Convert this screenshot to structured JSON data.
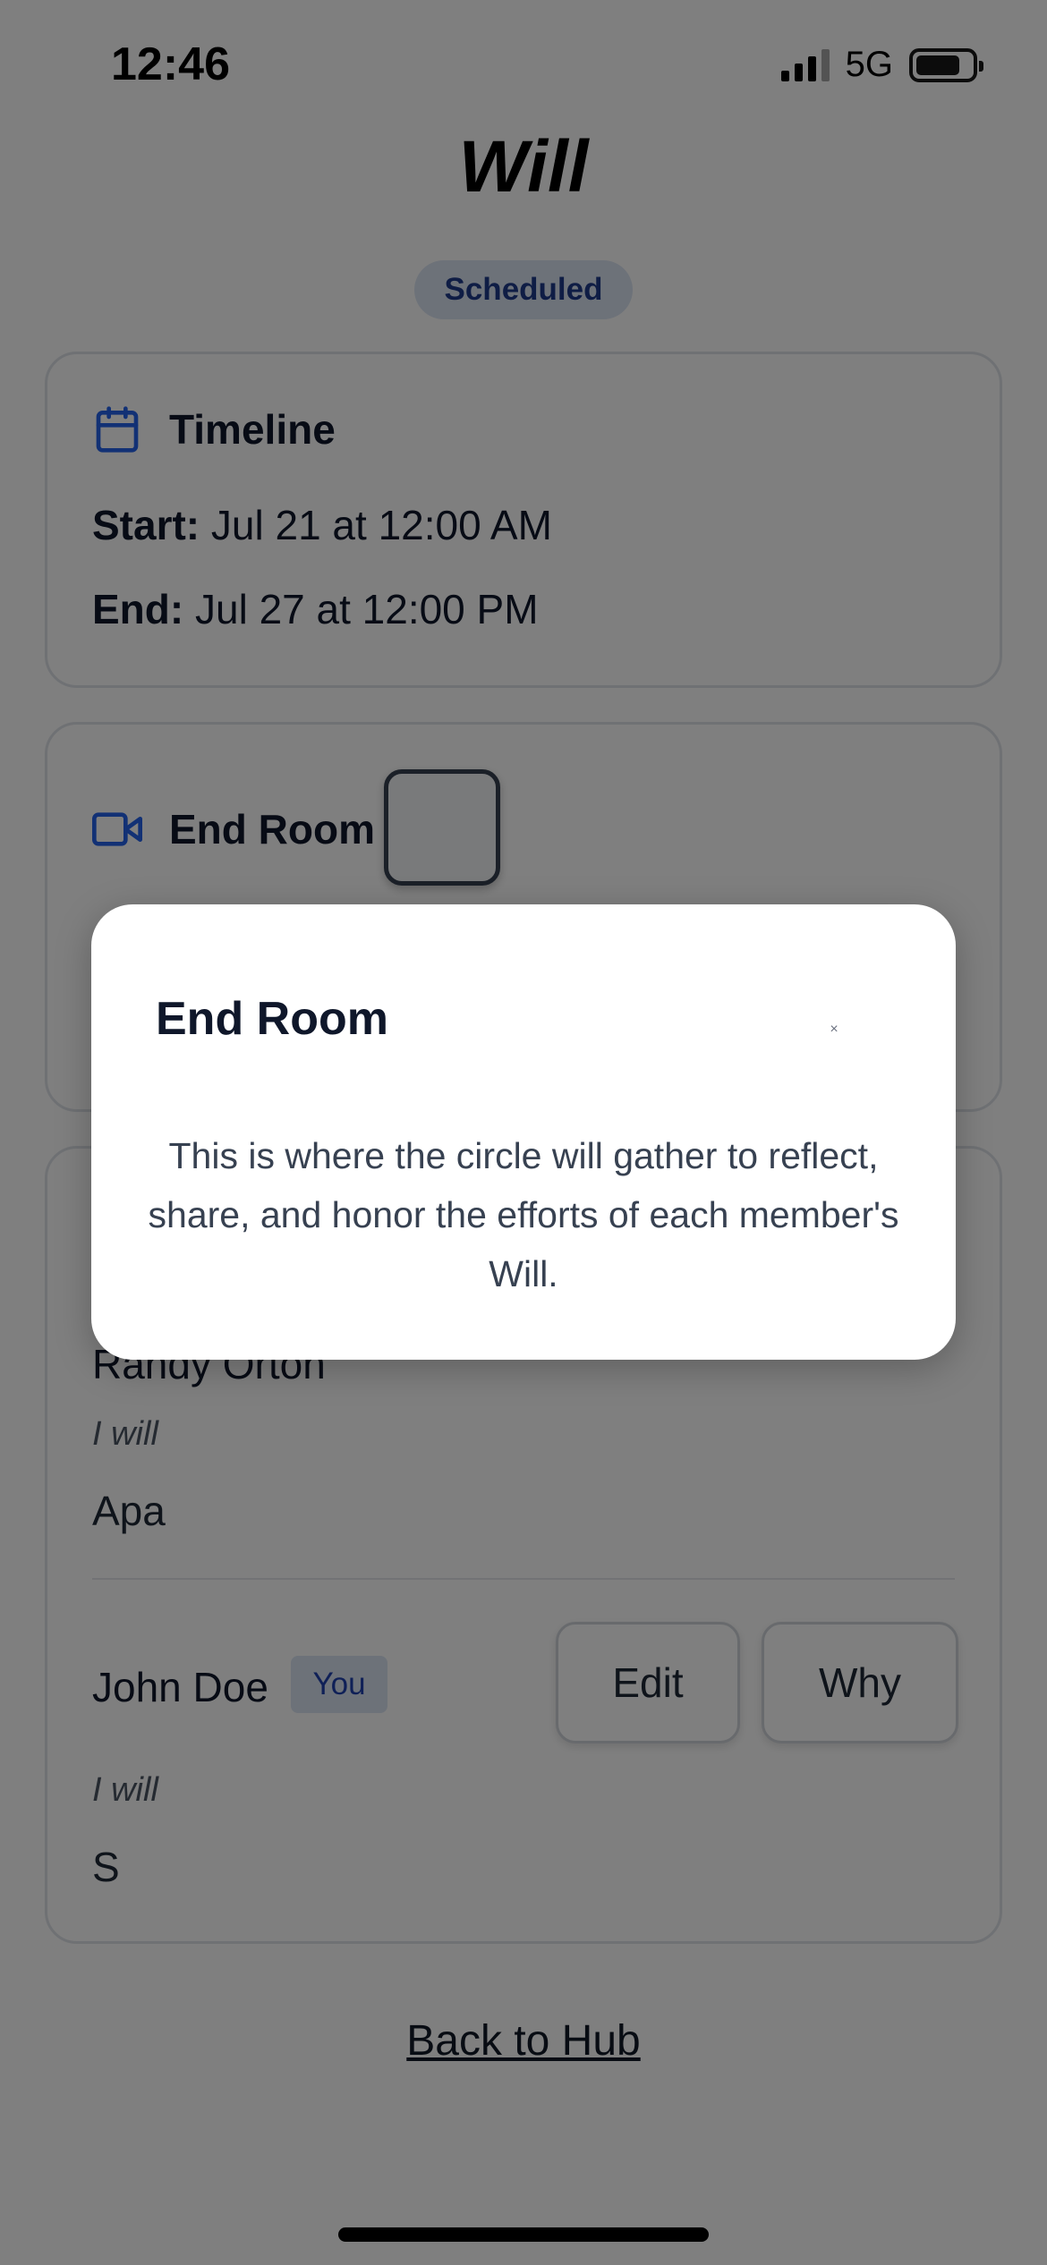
{
  "status_bar": {
    "time": "12:46",
    "network": "5G"
  },
  "header": {
    "title": "Will",
    "status_badge": "Scheduled"
  },
  "timeline": {
    "heading": "Timeline",
    "start_label": "Start:",
    "start_value": "Jul 21 at 12:00 AM",
    "end_label": "End:",
    "end_value": "Jul 27 at 12:00 PM"
  },
  "end_room": {
    "heading": "End Room"
  },
  "members": [
    {
      "name": "Randy Orton",
      "will_label": "I will",
      "will_text": "Apa"
    },
    {
      "name": "John Doe",
      "you_badge": "You",
      "will_label": "I will",
      "will_text": "S",
      "edit_label": "Edit",
      "why_label": "Why"
    }
  ],
  "footer": {
    "back_link": "Back to Hub"
  },
  "modal": {
    "title": "End Room",
    "close_glyph": "×",
    "body": "This is where the circle will gather to reflect, share, and honor the efforts of each member's Will."
  },
  "colors": {
    "accent": "#1e40af",
    "badge_bg": "#dbe4f3",
    "overlay": "rgba(0,0,0,0.5)"
  }
}
